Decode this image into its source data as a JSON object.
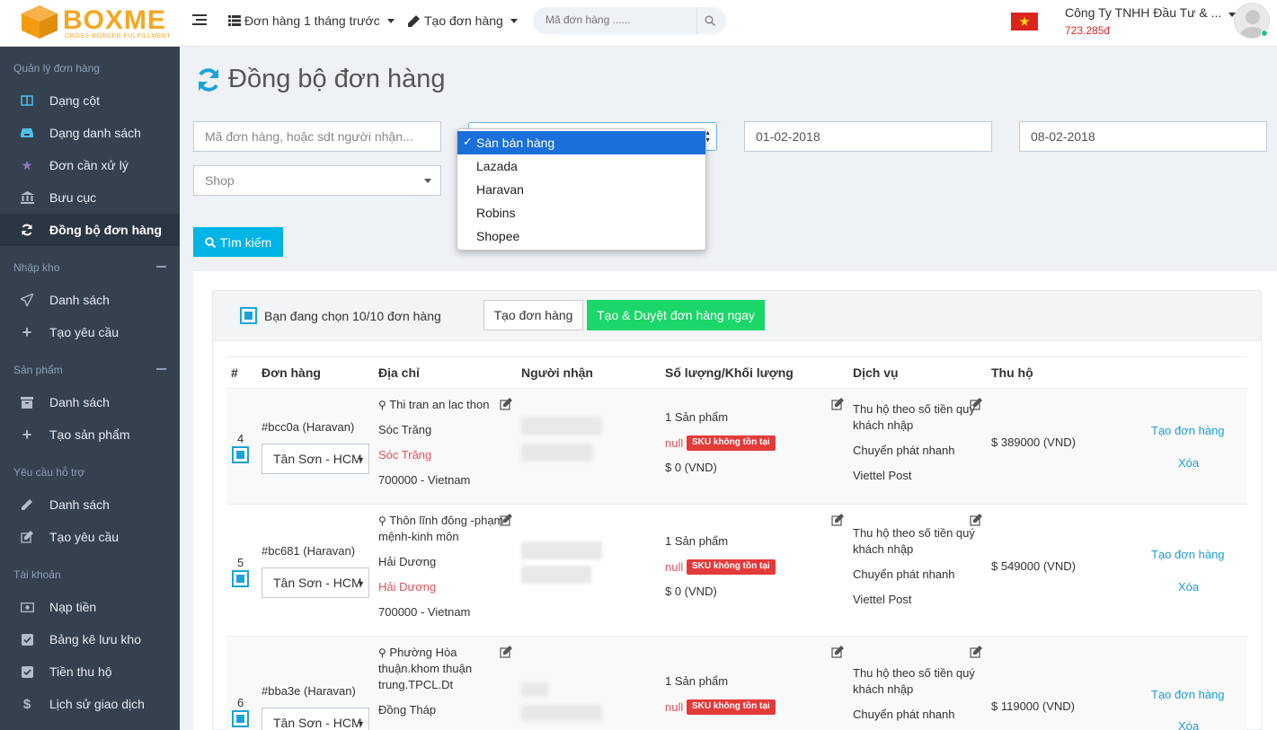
{
  "topbar": {
    "logo_text": "BOXME",
    "logo_sub": "CROSS-BORDER FULFILLMENT",
    "orders_filter": "Đơn hàng 1 tháng trước",
    "create_order": "Tạo đơn hàng",
    "search_placeholder": "Mã đơn hàng ......",
    "company": "Công Ty TNHH Đầu Tư & ...",
    "balance": "723.285đ"
  },
  "sidebar": {
    "sections": [
      {
        "title": "Quản lý đơn hàng"
      },
      {
        "title": "Nhập kho"
      },
      {
        "title": "Sản phẩm"
      },
      {
        "title": "Yêu cầu hỗ trợ"
      },
      {
        "title": "Tài khoản"
      }
    ],
    "items": [
      {
        "label": "Dạng cột",
        "icon": "columns-icon"
      },
      {
        "label": "Dạng danh sách",
        "icon": "inbox-icon"
      },
      {
        "label": "Đơn cần xử lý",
        "icon": "star-icon"
      },
      {
        "label": "Bưu cục",
        "icon": "bank-icon"
      },
      {
        "label": "Đồng bộ đơn hàng",
        "icon": "refresh-icon"
      },
      {
        "label": "Danh sách",
        "icon": "paper-plane-icon"
      },
      {
        "label": "Tạo yêu cầu",
        "icon": "plus-icon"
      },
      {
        "label": "Danh sách",
        "icon": "archive-icon"
      },
      {
        "label": "Tạo sản phẩm",
        "icon": "plus-icon"
      },
      {
        "label": "Danh sách",
        "icon": "pencil-icon"
      },
      {
        "label": "Tạo yêu cầu",
        "icon": "edit-icon"
      },
      {
        "label": "Nạp tiền",
        "icon": "money-icon"
      },
      {
        "label": "Bảng kê lưu kho",
        "icon": "check-square-icon"
      },
      {
        "label": "Tiền thu hộ",
        "icon": "check-square-icon"
      },
      {
        "label": "Lịch sử giao dịch",
        "icon": "dollar-icon"
      }
    ]
  },
  "page": {
    "title": "Đồng bộ đơn hàng"
  },
  "filters": {
    "order_placeholder": "Mã đơn hàng, hoặc sdt người nhận...",
    "shop_placeholder": "Shop",
    "date_from": "01-02-2018",
    "date_to": "08-02-2018",
    "search_button": "Tìm kiếm",
    "marketplace_options": [
      "Sàn bán hàng",
      "Lazada",
      "Haravan",
      "Robins",
      "Shopee"
    ],
    "marketplace_selected": "Sàn bán hàng"
  },
  "selection": {
    "text": "Bạn đang chọn 10/10 đơn hàng",
    "create_button": "Tạo đơn hàng",
    "create_approve_button": "Tạo & Duyệt đơn hàng ngay"
  },
  "table": {
    "headers": [
      "#",
      "Đơn hàng",
      "Địa chỉ",
      "Người nhận",
      "Số lượng/Khối lượng",
      "Dịch vụ",
      "Thu hộ"
    ],
    "rows": [
      {
        "num": "4",
        "order": "#bcc0a (Haravan)",
        "warehouse": "Tân Sơn - HCM",
        "address_lines": [
          "Thi tran an lac thon"
        ],
        "province": "Sóc Trăng",
        "province_red": "Sóc Trăng",
        "postal": "700000 - Vietnam",
        "qty": "1 Sản phẩm",
        "null_text": "null",
        "sku_badge": "SKU không tồn tại",
        "fee": "$ 0 (VND)",
        "service_lines": [
          "Thu hộ theo số tiền quý",
          "khách nhập"
        ],
        "service_type": "Chuyển phát nhanh",
        "carrier": "Viettel Post",
        "cod": "$ 389000 (VND)",
        "action_create": "Tạo đơn hàng",
        "action_delete": "Xóa"
      },
      {
        "num": "5",
        "order": "#bc681 (Haravan)",
        "warehouse": "Tân Sơn - HCM",
        "address_lines": [
          "Thôn lĩnh đông -phạm",
          "mệnh-kinh môn"
        ],
        "province": "Hải Dương",
        "province_red": "Hải Dương",
        "postal": "700000 - Vietnam",
        "qty": "1 Sản phẩm",
        "null_text": "null",
        "sku_badge": "SKU không tồn tại",
        "fee": "$ 0 (VND)",
        "service_lines": [
          "Thu hộ theo số tiền quý",
          "khách nhập"
        ],
        "service_type": "Chuyển phát nhanh",
        "carrier": "Viettel Post",
        "cod": "$ 549000 (VND)",
        "action_create": "Tạo đơn hàng",
        "action_delete": "Xóa"
      },
      {
        "num": "6",
        "order": "#bba3e (Haravan)",
        "warehouse": "Tân Sơn - HCM",
        "address_lines": [
          "Phường Hòa",
          "thuận.khom thuận",
          "trung.TPCL.Dt"
        ],
        "province": "Đồng Tháp",
        "qty": "1 Sản phẩm",
        "null_text": "null",
        "sku_badge": "SKU không tồn tại",
        "service_lines": [
          "Thu hộ theo số tiền quý",
          "khách nhập"
        ],
        "service_type": "Chuyển phát nhanh",
        "cod": "$ 119000 (VND)",
        "action_create": "Tạo đơn hàng",
        "action_delete": "Xóa"
      }
    ]
  },
  "colors": {
    "sidebar_bg": "#364150",
    "accent": "#00b4e6",
    "approve": "#1bd668",
    "danger": "#e33a3a",
    "brand": "#f5a623"
  }
}
